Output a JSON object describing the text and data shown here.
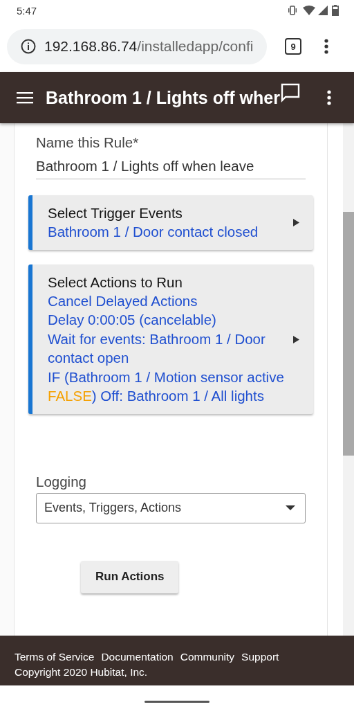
{
  "status_bar": {
    "time": "5:47"
  },
  "browser": {
    "url_host": "192.168.86.74",
    "url_path": "/installedapp/confi",
    "tab_count": "9"
  },
  "app_bar": {
    "title": "Bathroom 1 / Lights off wher"
  },
  "rule_name": {
    "label": "Name this Rule*",
    "value": "Bathroom 1 / Lights off when leave"
  },
  "sections": [
    {
      "title": "Select Trigger Events",
      "lines": [
        [
          {
            "text": "Bathroom 1 / Door contact closed",
            "kind": "link"
          }
        ]
      ]
    },
    {
      "title": "Select Actions to Run",
      "lines": [
        [
          {
            "text": "Cancel Delayed Actions",
            "kind": "link"
          }
        ],
        [
          {
            "text": "Delay 0:00:05 (cancelable)",
            "kind": "link"
          }
        ],
        [
          {
            "text": "Wait for events: Bathroom 1 / Door contact open",
            "kind": "link"
          }
        ],
        [
          {
            "text": "IF (Bathroom 1 / Motion sensor active ",
            "kind": "link"
          },
          {
            "text": "FALSE",
            "kind": "state"
          },
          {
            "text": ") Off: Bathroom 1 / All lights",
            "kind": "link"
          }
        ]
      ]
    }
  ],
  "logging": {
    "label": "Logging",
    "value": "Events, Triggers, Actions"
  },
  "run_button": "Run Actions",
  "footer": {
    "links": [
      "Terms of Service",
      "Documentation",
      "Community",
      "Support"
    ],
    "copyright": "Copyright 2020 Hubitat, Inc."
  }
}
